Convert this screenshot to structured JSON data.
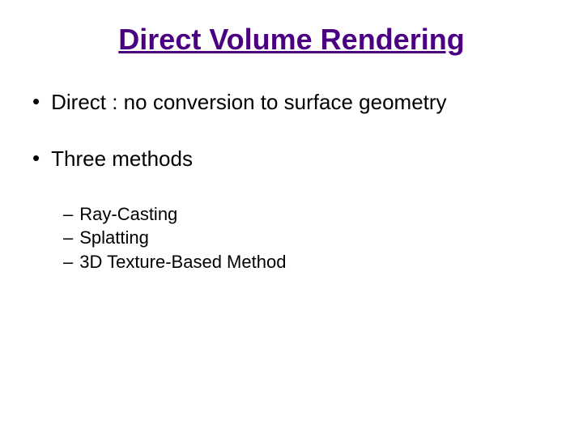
{
  "title": "Direct Volume Rendering",
  "bullets": [
    {
      "text": "Direct : no conversion to surface geometry",
      "subs": []
    },
    {
      "text": "Three methods",
      "subs": [
        "Ray-Casting",
        "Splatting",
        "3D Texture-Based Method"
      ]
    }
  ]
}
